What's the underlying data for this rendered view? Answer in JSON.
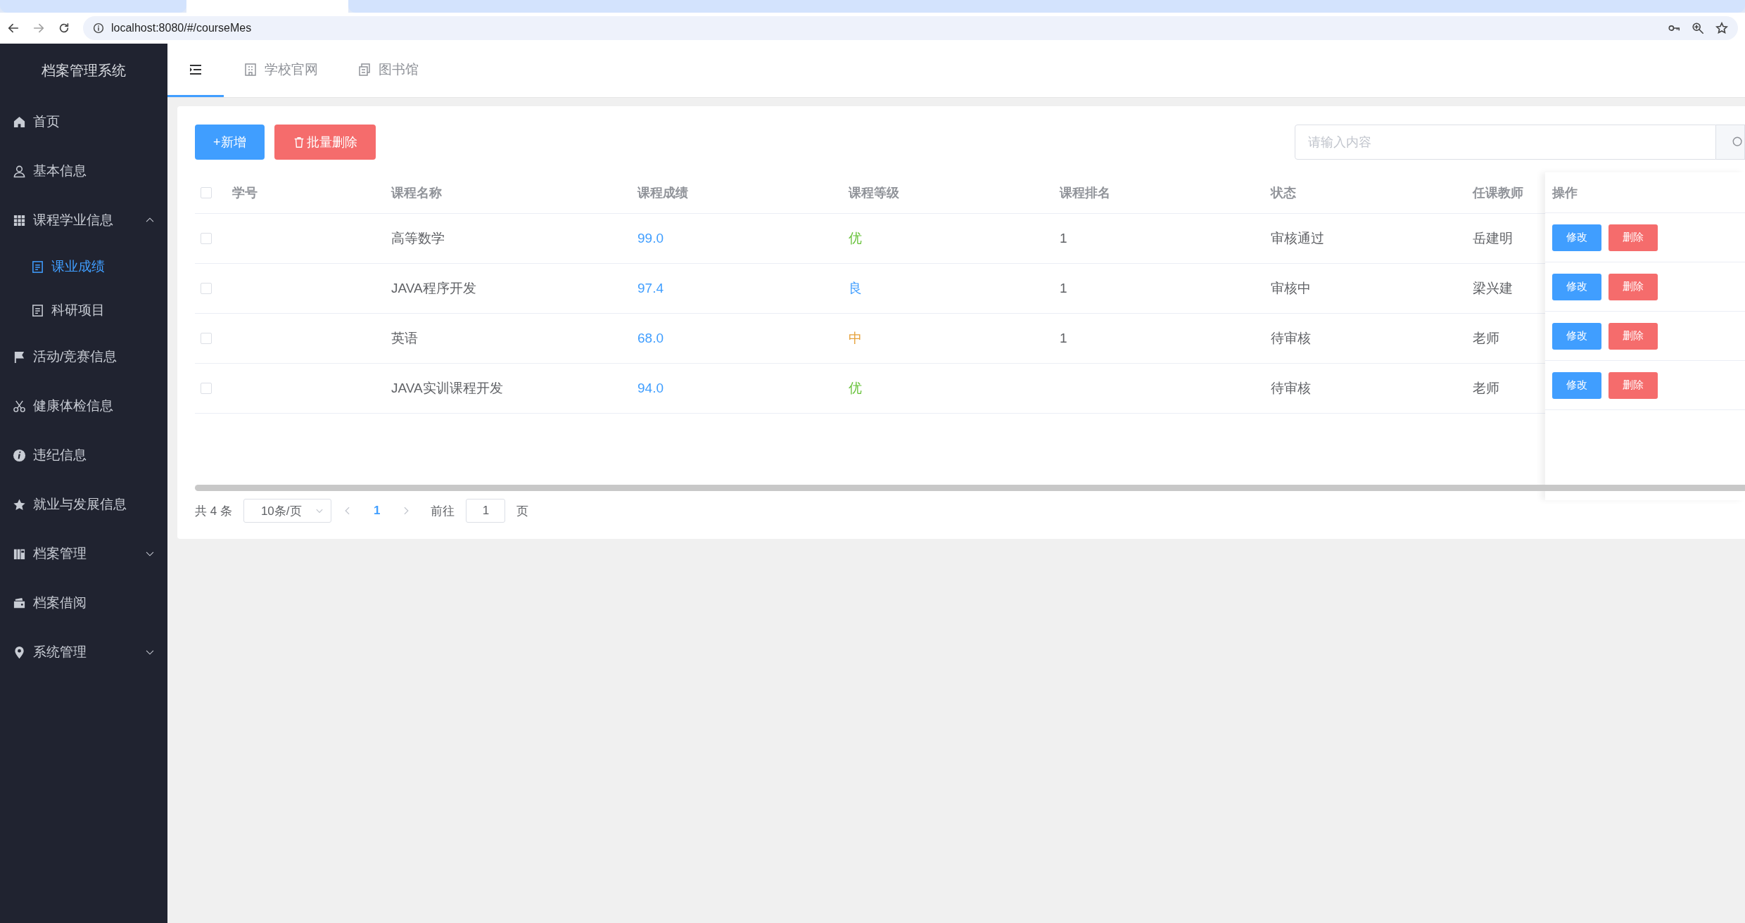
{
  "browser": {
    "tabs": [
      {
        "selected": false
      },
      {
        "selected": true
      },
      {
        "selected": false
      }
    ],
    "url": "localhost:8080/#/courseMes"
  },
  "sidebar": {
    "title": "档案管理系统",
    "items": [
      {
        "label": "首页",
        "selected": false
      },
      {
        "label": "基本信息",
        "selected": false
      },
      {
        "label": "课程学业信息",
        "selected": false,
        "expanded": true,
        "children": [
          {
            "label": "课业成绩",
            "selected": true
          },
          {
            "label": "科研项目",
            "selected": false
          }
        ]
      },
      {
        "label": "活动/竞赛信息",
        "selected": false
      },
      {
        "label": "健康体检信息",
        "selected": false
      },
      {
        "label": "违纪信息",
        "selected": false
      },
      {
        "label": "就业与发展信息",
        "selected": false
      },
      {
        "label": "档案管理",
        "selected": false,
        "expanded": false
      },
      {
        "label": "档案借阅",
        "selected": false
      },
      {
        "label": "系统管理",
        "selected": false,
        "expanded": false
      }
    ]
  },
  "header": {
    "tabs": [
      {
        "kind": "toggle",
        "selected": true
      },
      {
        "kind": "link",
        "label": "学校官网",
        "selected": false
      },
      {
        "kind": "link",
        "label": "图书馆",
        "selected": false
      }
    ]
  },
  "toolbar": {
    "buttons": [
      {
        "kind": "primary",
        "label": "+新增"
      },
      {
        "kind": "danger",
        "label": "批量删除"
      }
    ],
    "search": {
      "placeholder": "请输入内容"
    }
  },
  "table": {
    "select_all": {
      "checked": false
    },
    "columns": [
      "学号",
      "课程名称",
      "课程成绩",
      "课程等级",
      "课程排名",
      "状态",
      "任课教师",
      "操作"
    ],
    "rows": [
      {
        "checked": false,
        "student_id": "",
        "course": "高等数学",
        "score": "99.0",
        "grade": {
          "text": "优",
          "color": "#67c23a"
        },
        "rank": "1",
        "status": "审核通过",
        "teacher": "岳建明",
        "actions": [
          "修改",
          "删除"
        ]
      },
      {
        "checked": false,
        "student_id": "",
        "course": "JAVA程序开发",
        "score": "97.4",
        "grade": {
          "text": "良",
          "color": "#409eff"
        },
        "rank": "1",
        "status": "审核中",
        "teacher": "梁兴建",
        "actions": [
          "修改",
          "删除"
        ]
      },
      {
        "checked": false,
        "student_id": "",
        "course": "英语",
        "score": "68.0",
        "grade": {
          "text": "中",
          "color": "#e6a23c"
        },
        "rank": "1",
        "status": "待审核",
        "teacher": "老师",
        "actions": [
          "修改",
          "删除"
        ]
      },
      {
        "checked": false,
        "student_id": "",
        "course": "JAVA实训课程开发",
        "score": "94.0",
        "grade": {
          "text": "优",
          "color": "#67c23a"
        },
        "rank": "",
        "status": "待审核",
        "teacher": "老师",
        "actions": [
          "修改",
          "删除"
        ]
      }
    ]
  },
  "pagination": {
    "total": "共 4 条",
    "page_size": "10条/页",
    "pages": [
      {
        "label": "1",
        "selected": true
      }
    ],
    "goto_label": "前往",
    "goto_value": "1",
    "goto_suffix": "页"
  }
}
